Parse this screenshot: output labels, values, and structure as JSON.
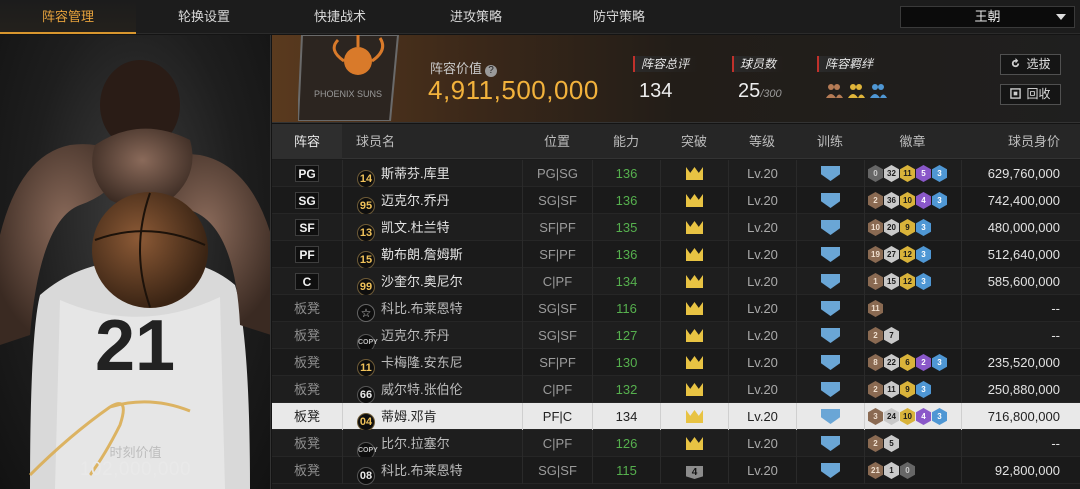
{
  "nav": {
    "tabs": [
      {
        "label": "阵容管理",
        "active": true
      },
      {
        "label": "轮换设置",
        "active": false
      },
      {
        "label": "快捷战术",
        "active": false
      },
      {
        "label": "进攻策略",
        "active": false
      },
      {
        "label": "防守策略",
        "active": false
      }
    ],
    "dropdown_value": "王朝"
  },
  "player_card": {
    "jersey_number": "21",
    "moment_label": "时刻价值",
    "moment_value": "102,000,000"
  },
  "summary": {
    "team_logo_text": "PHOENIX SUNS",
    "lineup_value_label": "阵容价值",
    "lineup_value": "4,911,500,000",
    "overall_label": "阵容总评",
    "overall_value": "134",
    "players_label": "球员数",
    "players_value": "25",
    "players_max": "/300",
    "chem_label": "阵容羁绊",
    "btn_select": "选拔",
    "btn_recycle": "回收"
  },
  "table": {
    "headers": [
      "阵容",
      "球员名",
      "位置",
      "能力",
      "突破",
      "等级",
      "训练",
      "徽章",
      "球员身价"
    ],
    "rows": [
      {
        "slot": "PG",
        "starter": true,
        "num": "14",
        "name": "斯蒂芬.库里",
        "pos": "PG|SG",
        "ability": "136",
        "breakthrough": "",
        "level": "Lv.20",
        "badges": [
          [
            "0",
            "f"
          ],
          [
            "32",
            "b"
          ],
          [
            "11",
            "c"
          ],
          [
            "5",
            "d"
          ],
          [
            "3",
            "e"
          ]
        ],
        "value": "629,760,000"
      },
      {
        "slot": "SG",
        "starter": true,
        "num": "95",
        "name": "迈克尔.乔丹",
        "pos": "SG|SF",
        "ability": "136",
        "breakthrough": "",
        "level": "Lv.20",
        "badges": [
          [
            "2",
            "a"
          ],
          [
            "36",
            "b"
          ],
          [
            "10",
            "c"
          ],
          [
            "4",
            "d"
          ],
          [
            "3",
            "e"
          ]
        ],
        "value": "742,400,000"
      },
      {
        "slot": "SF",
        "starter": true,
        "num": "13",
        "name": "凯文.杜兰特",
        "pos": "SF|PF",
        "ability": "135",
        "breakthrough": "",
        "level": "Lv.20",
        "badges": [
          [
            "10",
            "a"
          ],
          [
            "20",
            "b"
          ],
          [
            "9",
            "c"
          ],
          [
            "3",
            "e"
          ]
        ],
        "value": "480,000,000"
      },
      {
        "slot": "PF",
        "starter": true,
        "num": "15",
        "name": "勒布朗.詹姆斯",
        "pos": "SF|PF",
        "ability": "136",
        "breakthrough": "",
        "level": "Lv.20",
        "badges": [
          [
            "19",
            "a"
          ],
          [
            "27",
            "b"
          ],
          [
            "12",
            "c"
          ],
          [
            "3",
            "e"
          ]
        ],
        "value": "512,640,000"
      },
      {
        "slot": "C",
        "starter": true,
        "num": "99",
        "name": "沙奎尔.奥尼尔",
        "pos": "C|PF",
        "ability": "134",
        "breakthrough": "",
        "level": "Lv.20",
        "badges": [
          [
            "1",
            "a"
          ],
          [
            "15",
            "b"
          ],
          [
            "12",
            "c"
          ],
          [
            "3",
            "e"
          ]
        ],
        "value": "585,600,000"
      },
      {
        "slot": "板凳",
        "starter": false,
        "num": "☆",
        "name": "科比.布莱恩特",
        "pos": "SG|SF",
        "ability": "116",
        "breakthrough": "",
        "level": "Lv.20",
        "badges": [
          [
            "11",
            "a"
          ]
        ],
        "value": "--"
      },
      {
        "slot": "板凳",
        "starter": false,
        "num": "COPY",
        "name": "迈克尔.乔丹",
        "pos": "SG|SF",
        "ability": "127",
        "breakthrough": "",
        "level": "Lv.20",
        "badges": [
          [
            "2",
            "a"
          ],
          [
            "7",
            "b"
          ]
        ],
        "value": "--"
      },
      {
        "slot": "板凳",
        "starter": false,
        "num": "11",
        "name": "卡梅隆.安东尼",
        "pos": "SF|PF",
        "ability": "130",
        "breakthrough": "",
        "level": "Lv.20",
        "badges": [
          [
            "8",
            "a"
          ],
          [
            "22",
            "b"
          ],
          [
            "6",
            "c"
          ],
          [
            "2",
            "d"
          ],
          [
            "3",
            "e"
          ]
        ],
        "value": "235,520,000"
      },
      {
        "slot": "板凳",
        "starter": false,
        "num": "66",
        "name": "威尔特.张伯伦",
        "pos": "C|PF",
        "ability": "132",
        "breakthrough": "",
        "level": "Lv.20",
        "badges": [
          [
            "2",
            "a"
          ],
          [
            "11",
            "b"
          ],
          [
            "9",
            "c"
          ],
          [
            "3",
            "e"
          ]
        ],
        "value": "250,880,000"
      },
      {
        "slot": "板凳",
        "starter": false,
        "selected": true,
        "num": "04",
        "name": "蒂姆.邓肯",
        "pos": "PF|C",
        "ability": "134",
        "breakthrough": "",
        "level": "Lv.20",
        "badges": [
          [
            "3",
            "a"
          ],
          [
            "24",
            "b"
          ],
          [
            "10",
            "c"
          ],
          [
            "4",
            "d"
          ],
          [
            "3",
            "e"
          ]
        ],
        "value": "716,800,000"
      },
      {
        "slot": "板凳",
        "starter": false,
        "num": "COPY",
        "name": "比尔.拉塞尔",
        "pos": "C|PF",
        "ability": "126",
        "breakthrough": "",
        "level": "Lv.20",
        "badges": [
          [
            "2",
            "a"
          ],
          [
            "5",
            "b"
          ]
        ],
        "value": "--"
      },
      {
        "slot": "板凳",
        "starter": false,
        "num": "08",
        "name": "科比.布莱恩特",
        "pos": "SG|SF",
        "ability": "115",
        "breakthrough": "4",
        "level": "Lv.20",
        "badges": [
          [
            "21",
            "a"
          ],
          [
            "1",
            "b"
          ],
          [
            "0",
            "f"
          ]
        ],
        "value": "92,800,000"
      }
    ]
  },
  "colors": {
    "accent": "#e6a23c",
    "ability_green": "#56b04e",
    "crown_gold": "#e8c343",
    "training_blue": "#6aa6d6"
  }
}
